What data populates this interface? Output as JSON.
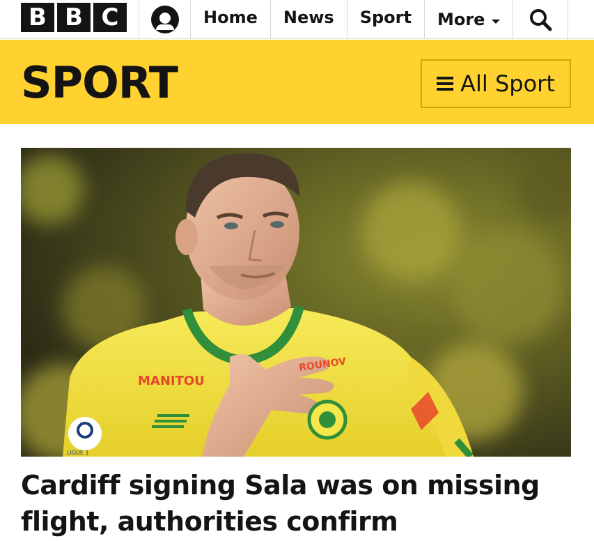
{
  "brand": {
    "letters": [
      "B",
      "B",
      "C"
    ]
  },
  "nav": {
    "items": [
      {
        "label": "Home"
      },
      {
        "label": "News"
      },
      {
        "label": "Sport"
      },
      {
        "label": "More"
      }
    ],
    "search_icon": "search-icon",
    "account_icon": "account-icon"
  },
  "sport_header": {
    "title": "SPORT",
    "all_sport_label": "All Sport",
    "menu_icon": "hamburger-icon"
  },
  "article": {
    "headline": "Cardiff signing Sala was on missing flight, authorities confirm",
    "image_shirt_text": [
      "MANITOU",
      "ROUNOV",
      "LIGUE 1"
    ]
  },
  "colors": {
    "sport_yellow": "#ffd230",
    "bbc_black": "#141414",
    "kit_yellow": "#f2e14a",
    "kit_green": "#2f8f3a",
    "sponsor_red": "#e8482a"
  }
}
